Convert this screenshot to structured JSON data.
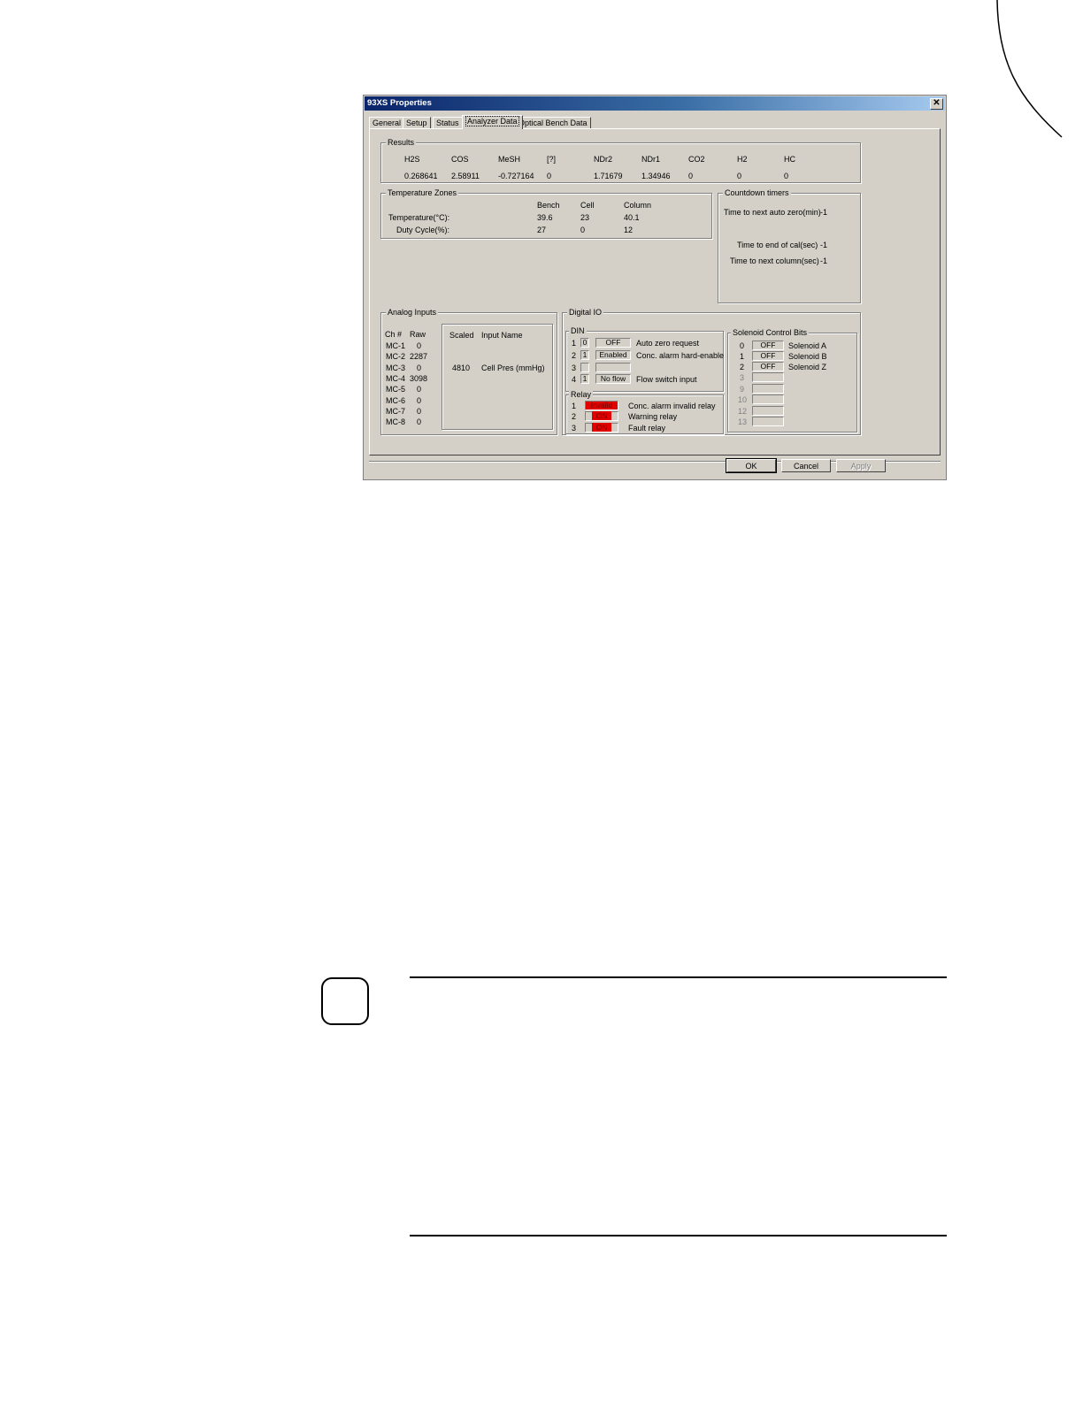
{
  "dialog": {
    "title": "93XS Properties",
    "close_label": "✕"
  },
  "tabs": [
    "General",
    "Setup",
    "Status",
    "Analyzer Data",
    "Optical Bench Data"
  ],
  "results": {
    "label": "Results",
    "headers": [
      "H2S",
      "COS",
      "MeSH",
      "[?]",
      "NDr2",
      "NDr1",
      "CO2",
      "H2",
      "HC"
    ],
    "values": [
      "0.268641",
      "2.58911",
      "-0.727164",
      "0",
      "1.71679",
      "1.34946",
      "0",
      "0",
      "0"
    ]
  },
  "temperature": {
    "label": "Temperature Zones",
    "col_headers": [
      "Bench",
      "Cell",
      "Column"
    ],
    "rows": [
      {
        "label": "Temperature(°C):",
        "values": [
          "39.6",
          "23",
          "40.1"
        ]
      },
      {
        "label": "Duty Cycle(%):",
        "values": [
          "27",
          "0",
          "12"
        ]
      }
    ]
  },
  "countdown": {
    "label": "Countdown timers",
    "rows": [
      {
        "label": "Time to next auto zero(min)",
        "value": "-1"
      },
      {
        "label": "Time to end of cal(sec)",
        "value": "-1"
      },
      {
        "label": "Time to next column(sec)",
        "value": "-1"
      }
    ]
  },
  "analog": {
    "label": "Analog Inputs",
    "headers": {
      "ch": "Ch #",
      "raw": "Raw",
      "scaled": "Scaled",
      "name": "Input Name"
    },
    "channels": [
      {
        "ch": "MC-1",
        "raw": "0"
      },
      {
        "ch": "MC-2",
        "raw": "2287"
      },
      {
        "ch": "MC-3",
        "raw": "0"
      },
      {
        "ch": "MC-4",
        "raw": "3098"
      },
      {
        "ch": "MC-5",
        "raw": "0"
      },
      {
        "ch": "MC-6",
        "raw": "0"
      },
      {
        "ch": "MC-7",
        "raw": "0"
      },
      {
        "ch": "MC-8",
        "raw": "0"
      }
    ],
    "scaled_row": {
      "value": "4810",
      "name": "Cell Pres (mmHg)"
    }
  },
  "digital": {
    "label": "Digital IO",
    "din": {
      "label": "DIN",
      "rows": [
        {
          "num": "1",
          "bit": "0",
          "state": "OFF",
          "desc": "Auto zero request"
        },
        {
          "num": "2",
          "bit": "1",
          "state": "Enabled",
          "desc": "Conc. alarm hard-enable"
        },
        {
          "num": "3",
          "bit": "",
          "state": "",
          "desc": ""
        },
        {
          "num": "4",
          "bit": "1",
          "state": "No flow",
          "desc": "Flow switch input"
        }
      ]
    },
    "relay": {
      "label": "Relay",
      "rows": [
        {
          "num": "1",
          "state": "Invalid",
          "desc": "Conc. alarm invalid relay"
        },
        {
          "num": "2",
          "state": "ON",
          "desc": "Warning relay"
        },
        {
          "num": "3",
          "state": "ON",
          "desc": "Fault relay"
        }
      ]
    },
    "solenoid": {
      "label": "Solenoid Control Bits",
      "rows": [
        {
          "num": "0",
          "state": "OFF",
          "desc": "Solenoid A"
        },
        {
          "num": "1",
          "state": "OFF",
          "desc": "Solenoid B"
        },
        {
          "num": "2",
          "state": "OFF",
          "desc": "Solenoid Z"
        },
        {
          "num": "3",
          "state": "",
          "desc": ""
        },
        {
          "num": "9",
          "state": "",
          "desc": ""
        },
        {
          "num": "10",
          "state": "",
          "desc": ""
        },
        {
          "num": "12",
          "state": "",
          "desc": ""
        },
        {
          "num": "13",
          "state": "",
          "desc": ""
        }
      ]
    }
  },
  "buttons": {
    "ok": "OK",
    "cancel": "Cancel",
    "apply": "Apply"
  },
  "colors": {
    "relay_active": "#e00000",
    "titlebar": "#0a246a",
    "dialog_bg": "#d4d0c8"
  }
}
